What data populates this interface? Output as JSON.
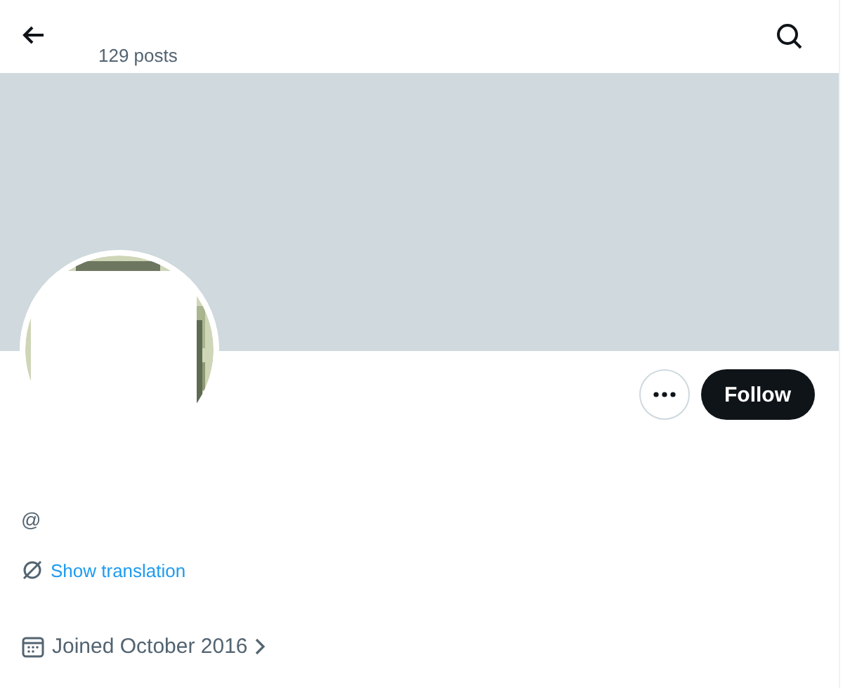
{
  "header": {
    "post_count": "129 posts"
  },
  "profile": {
    "handle": "@",
    "translation_link": "Show translation",
    "joined": "Joined October 2016"
  },
  "actions": {
    "follow_label": "Follow"
  }
}
